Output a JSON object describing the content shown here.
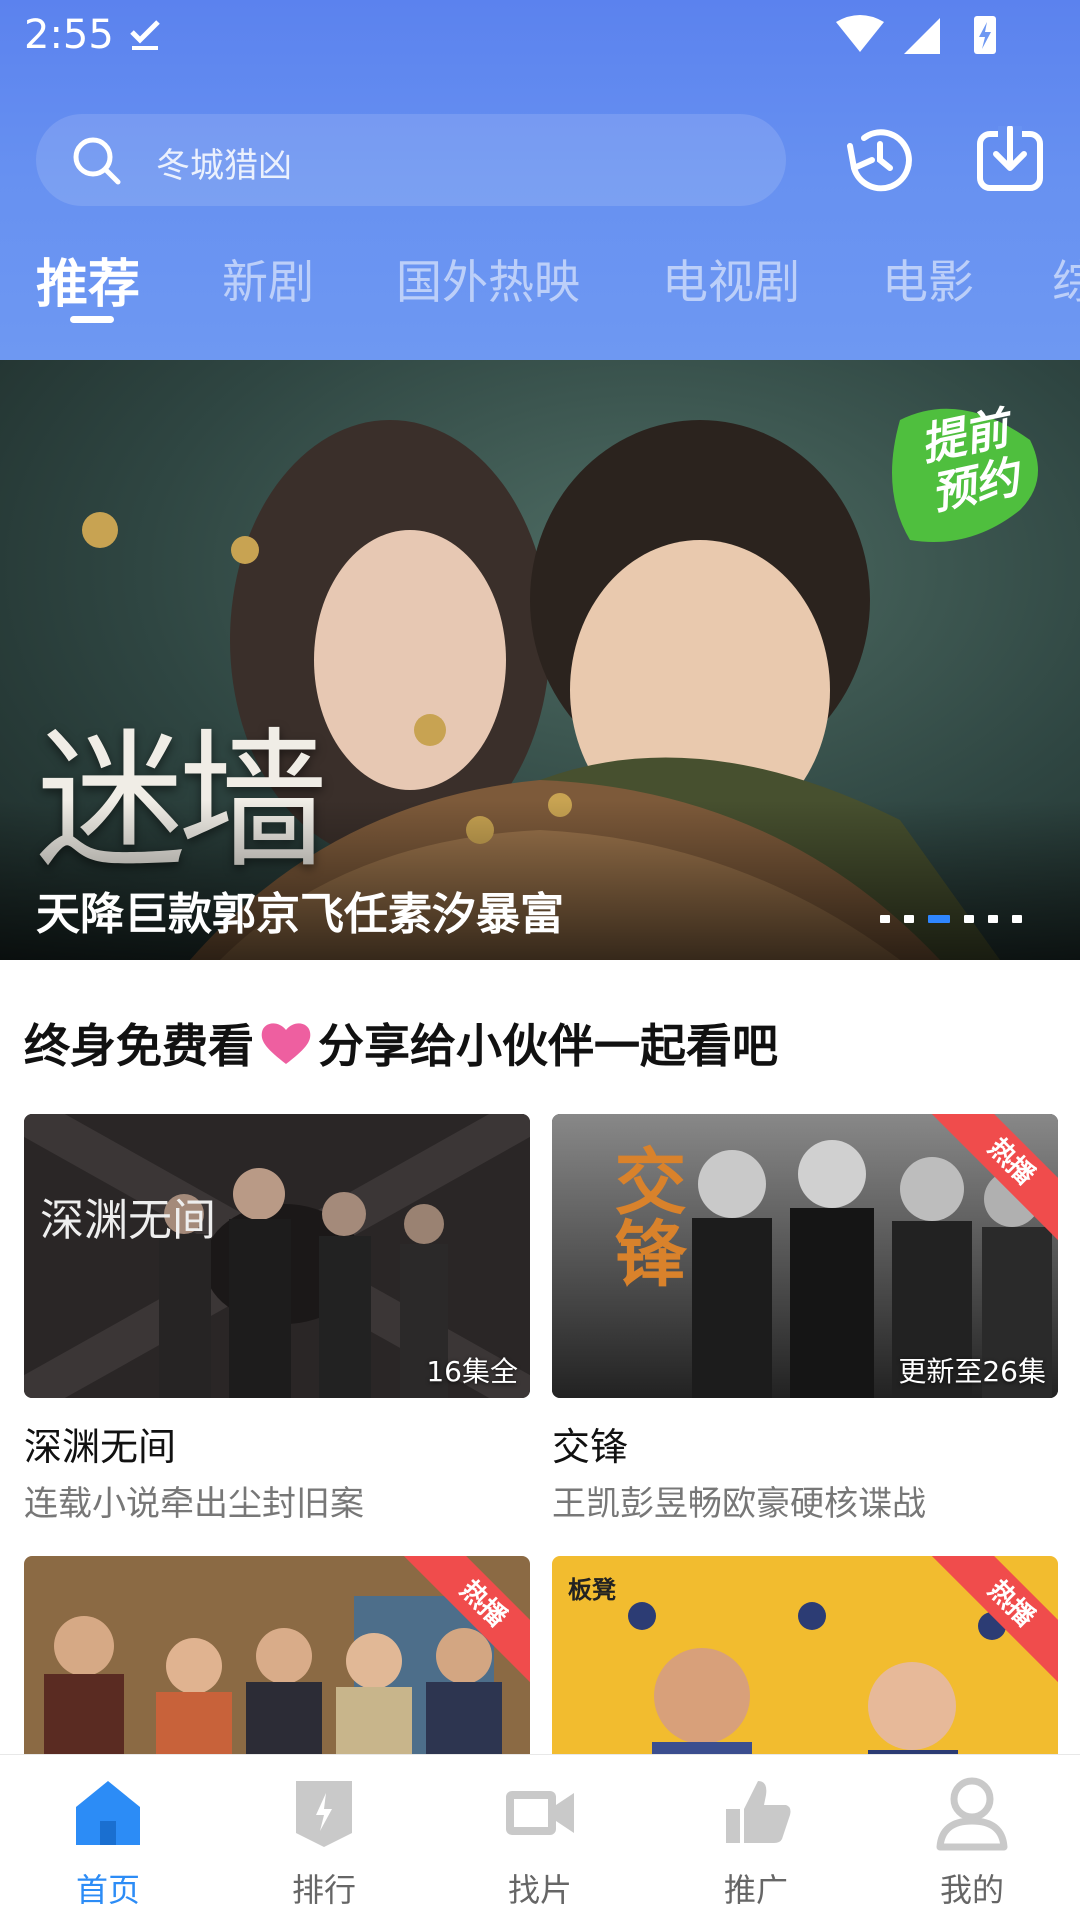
{
  "status_bar": {
    "time": "2:55"
  },
  "search": {
    "placeholder": "冬城猎凶"
  },
  "tabs": [
    "推荐",
    "新剧",
    "国外热映",
    "电视剧",
    "电影",
    "综"
  ],
  "banner": {
    "logo_text": "迷墙",
    "badge": "提前预约",
    "caption": "天降巨款郭京飞任素汐暴富",
    "dots_total": 6,
    "active_dot": 3
  },
  "section": {
    "title_left": "终身免费看",
    "title_right": "分享给小伙伴一起看吧"
  },
  "cards": [
    {
      "title": "深渊无间",
      "subtitle": "连载小说牵出尘封旧案",
      "episodes": "16集全",
      "hot": "",
      "poster_text": "深渊无间"
    },
    {
      "title": "交锋",
      "subtitle": "王凯彭昱畅欧豪硬核谍战",
      "episodes": "更新至26集",
      "hot": "热播",
      "poster_text": "交锋"
    },
    {
      "title": "",
      "subtitle": "",
      "episodes": "",
      "hot": "热播",
      "poster_text": ""
    },
    {
      "title": "",
      "subtitle": "",
      "episodes": "",
      "hot": "热播",
      "poster_text": "板凳"
    }
  ],
  "bottom_nav": [
    {
      "label": "首页",
      "icon": "home-icon",
      "active": true
    },
    {
      "label": "排行",
      "icon": "ranking-icon",
      "active": false
    },
    {
      "label": "找片",
      "icon": "video-camera-icon",
      "active": false
    },
    {
      "label": "推广",
      "icon": "thumbs-up-icon",
      "active": false
    },
    {
      "label": "我的",
      "icon": "user-icon",
      "active": false
    }
  ],
  "colors": {
    "header_blue": "#6690f1",
    "accent_blue": "#2c8cf6",
    "hot_red": "#f04c4c",
    "heart_pink": "#ee5fa0"
  }
}
